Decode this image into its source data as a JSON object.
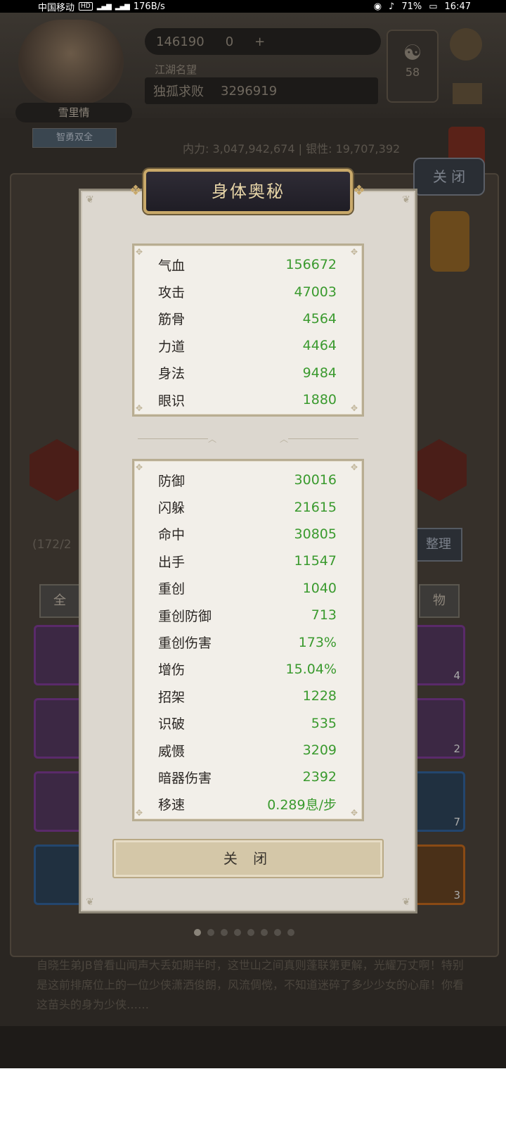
{
  "status_bar": {
    "carrier": "中国移动",
    "hd": "HD",
    "speed": "176B/s",
    "battery": "71%",
    "time": "16:47"
  },
  "background": {
    "player_name": "雪里情",
    "title_badge": "智勇双全",
    "currency_gold": "146190",
    "currency_jade": "0",
    "fame_label": "江湖名望",
    "fame_rank": "独孤求败",
    "fame_value": "3296919",
    "level_badge": "58",
    "power_text": "内力: 3,047,942,674 | 银性: 19,707,392",
    "close_tab": "关 闭",
    "sort_button": "整理",
    "filter_all": "全",
    "filter_items": "物",
    "capacity": "(172/2",
    "description": "自晓生弟JB曾看山闻声大丢如期半时，这世山之间真则蓬联第更解，光耀万丈啊！特别是这前排席位上的一位少侠潇洒俊朗，风流倜傥，不知道迷碎了多少少女的心扉！你看这苗头的身为少侠……"
  },
  "modal": {
    "title": "身体奥秘",
    "close_label": "关 闭",
    "primary_stats": [
      {
        "label": "气血",
        "value": "156672"
      },
      {
        "label": "攻击",
        "value": "47003"
      },
      {
        "label": "筋骨",
        "value": "4564"
      },
      {
        "label": "力道",
        "value": "4464"
      },
      {
        "label": "身法",
        "value": "9484"
      },
      {
        "label": "眼识",
        "value": "1880"
      }
    ],
    "secondary_stats": [
      {
        "label": "防御",
        "value": "30016"
      },
      {
        "label": "闪躲",
        "value": "21615"
      },
      {
        "label": "命中",
        "value": "30805"
      },
      {
        "label": "出手",
        "value": "11547"
      },
      {
        "label": "重创",
        "value": "1040"
      },
      {
        "label": "重创防御",
        "value": "713"
      },
      {
        "label": "重创伤害",
        "value": "173%"
      },
      {
        "label": "增伤",
        "value": "15.04%"
      },
      {
        "label": "招架",
        "value": "1228"
      },
      {
        "label": "识破",
        "value": "535"
      },
      {
        "label": "威慑",
        "value": "3209"
      },
      {
        "label": "暗器伤害",
        "value": "2392"
      },
      {
        "label": "移速",
        "value": "0.289息/步"
      }
    ]
  },
  "colors": {
    "stat_value": "#3a9a2e",
    "title_text": "#e8d6a8",
    "title_border": "#c9a96a",
    "modal_bg": "#dcd7cf"
  },
  "slot_counts": [
    "4",
    "2",
    "7",
    "3"
  ]
}
